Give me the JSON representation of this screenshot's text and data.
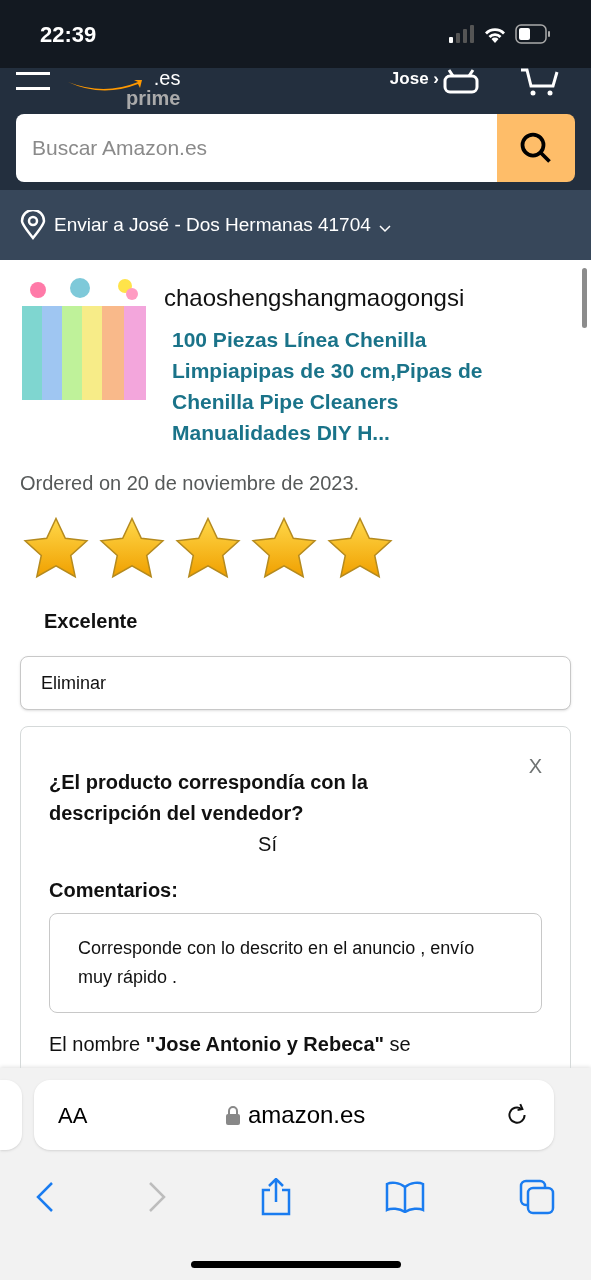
{
  "status_bar": {
    "time": "22:39"
  },
  "header": {
    "logo_suffix": ".es",
    "logo_tag": "prime",
    "account": "Jose ›",
    "search": {
      "placeholder": "Buscar Amazon.es"
    }
  },
  "location": {
    "text": "Enviar a José - Dos Hermanas 41704"
  },
  "product": {
    "seller": "chaoshengshangmaogongsi",
    "title": "100 Piezas Línea Chenilla Limpiapipas de 30 cm,Pipas de Chenilla Pipe Cleaners Manualidades DIY H..."
  },
  "order_date": "Ordered on 20 de noviembre de 2023.",
  "rating": {
    "stars": 5,
    "label": "Excelente"
  },
  "delete_button": "Eliminar",
  "feedback": {
    "close": "X",
    "question": "¿El producto correspondía con la descripción del vendedor?",
    "answer": "Sí",
    "comments_label": "Comentarios:",
    "comment": "Corresponde con lo descrito en el anuncio , envío muy rápido .",
    "notice": "El nombre **\"Jose Antonio y Rebeca\"** se"
  },
  "browser": {
    "text_size": "AA",
    "address": "amazon.es",
    "forward_disabled": true
  }
}
